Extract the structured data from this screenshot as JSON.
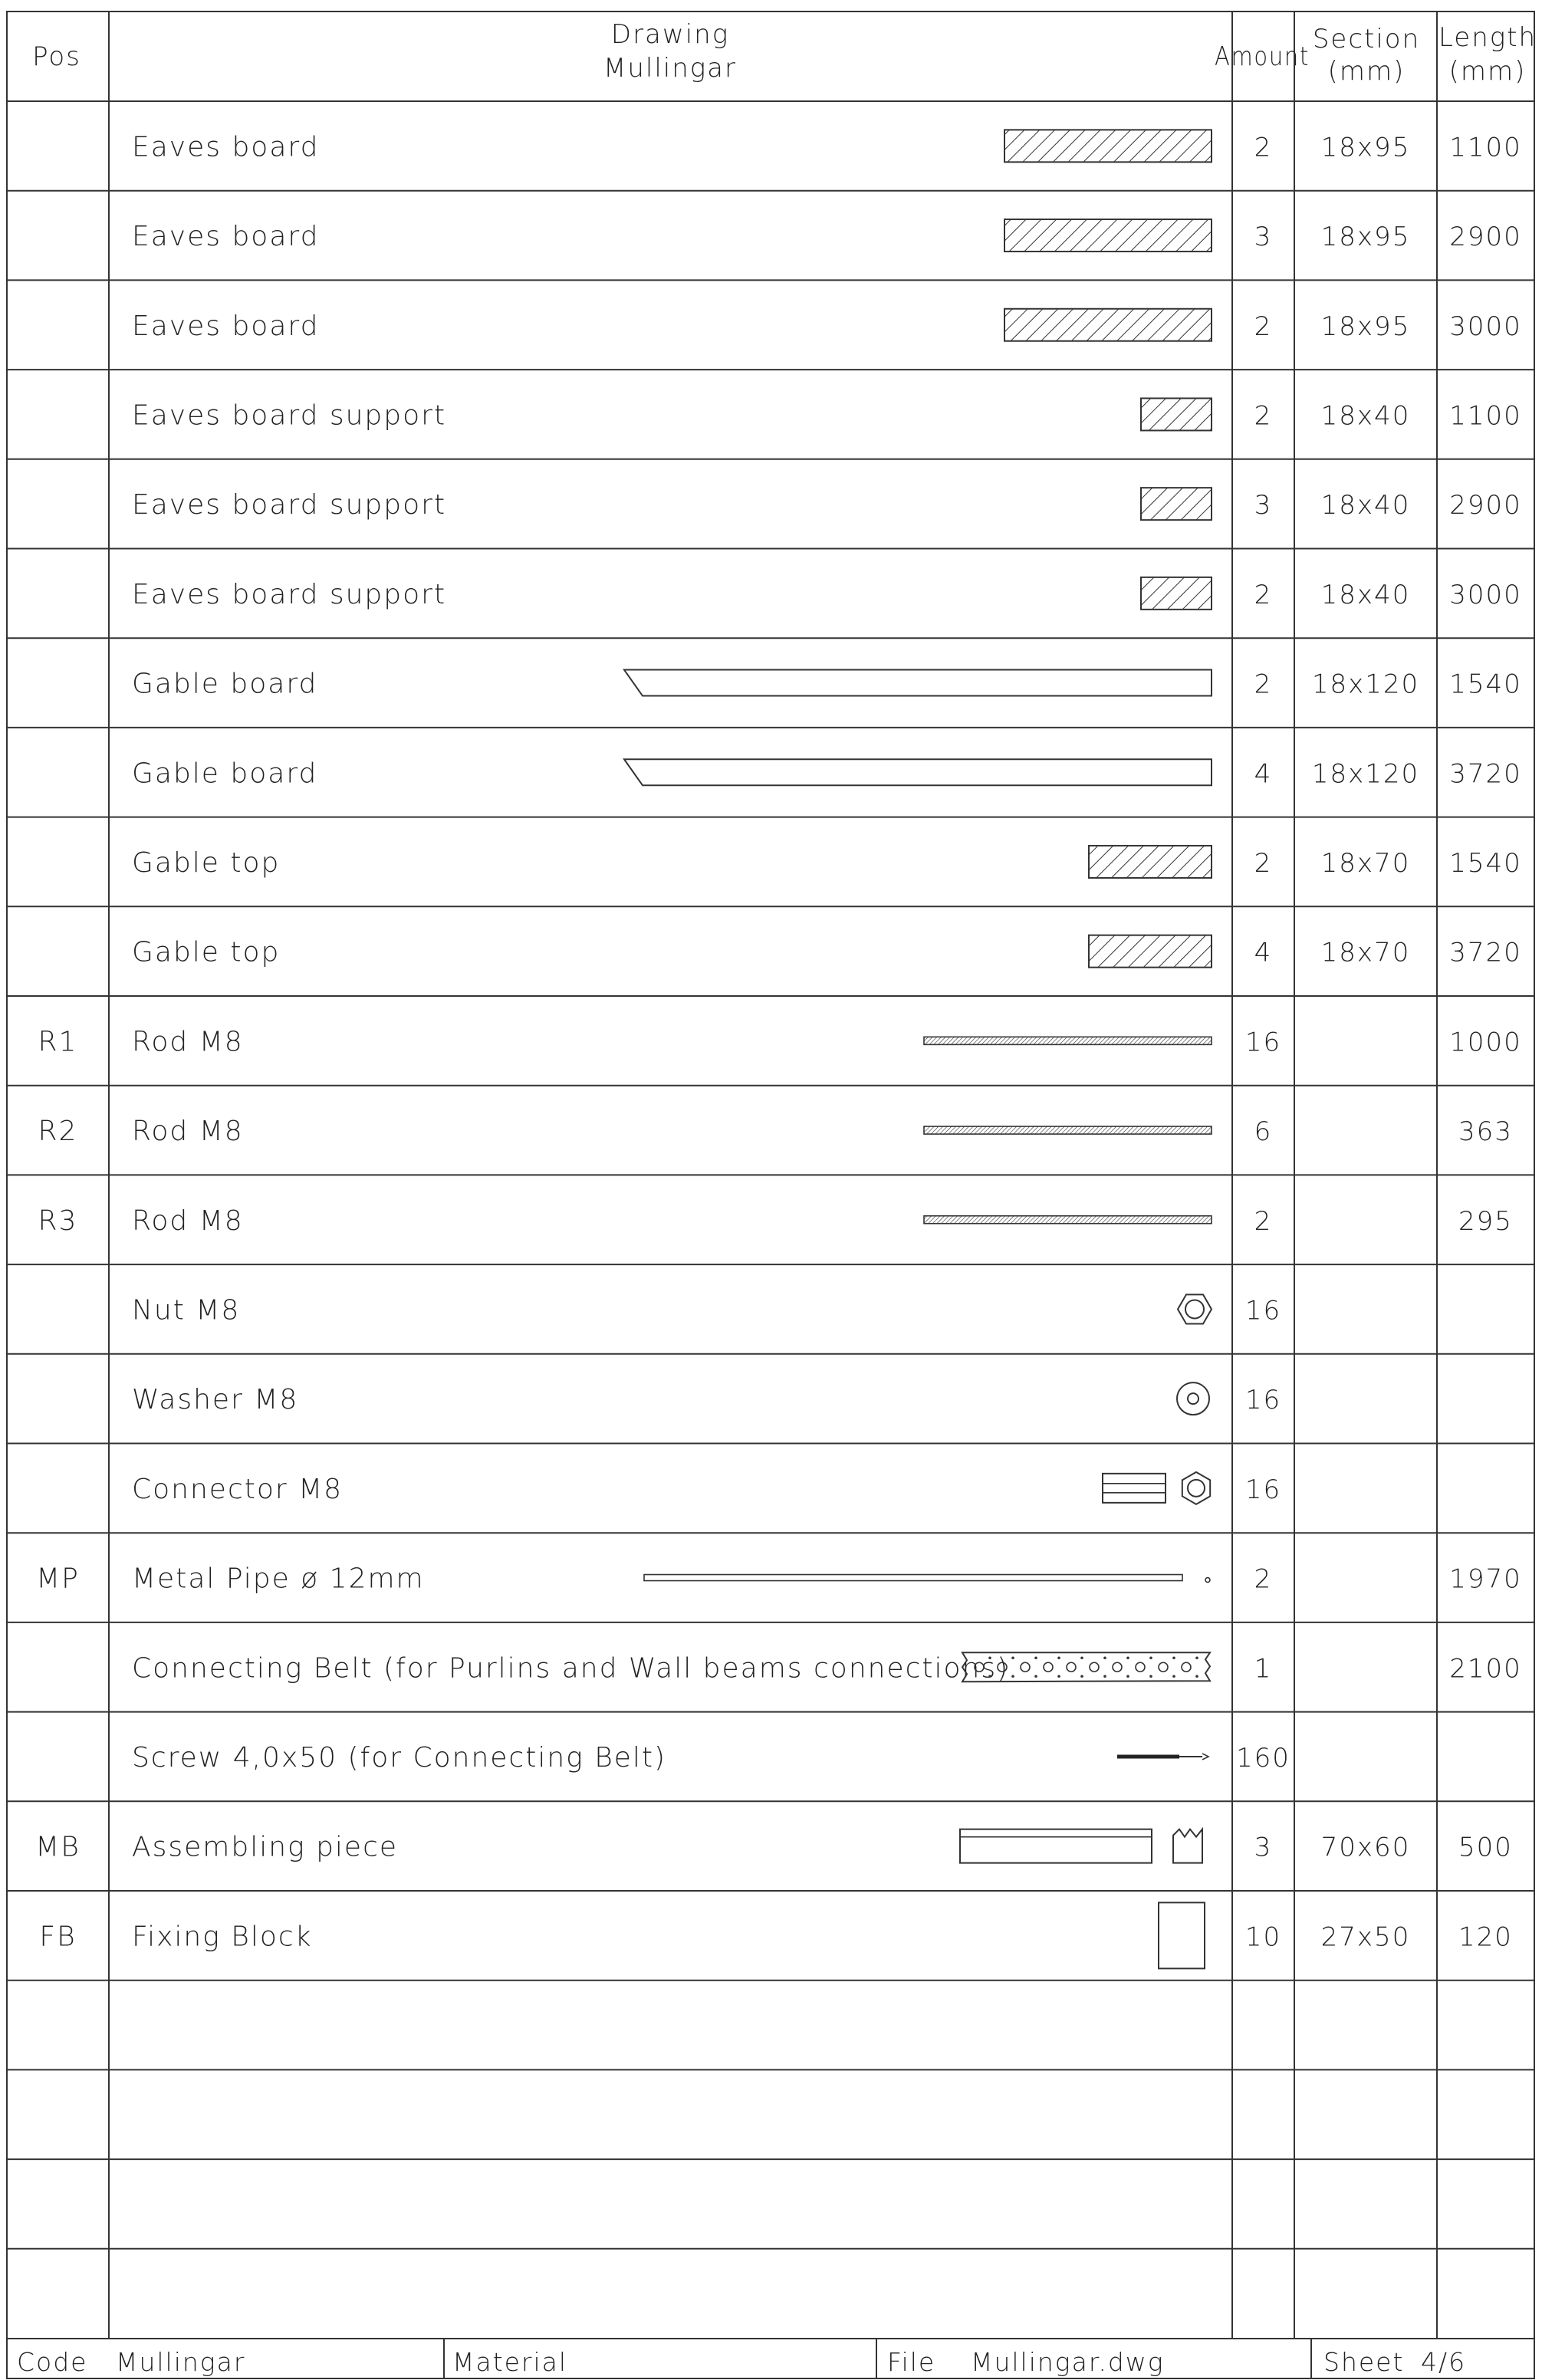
{
  "header": {
    "pos": "Pos",
    "drawing_line1": "Drawing",
    "drawing_line2": "Mullingar",
    "amount": "Amount",
    "section_line1": "Section",
    "section_line2": "(mm)",
    "length_line1": "Length",
    "length_line2": "(mm)"
  },
  "rows": [
    {
      "pos": "",
      "name": "Eaves board",
      "amount": "2",
      "section": "18x95",
      "length": "1100",
      "icon": "hatched-board-icon"
    },
    {
      "pos": "",
      "name": "Eaves board",
      "amount": "3",
      "section": "18x95",
      "length": "2900",
      "icon": "hatched-board-icon"
    },
    {
      "pos": "",
      "name": "Eaves board",
      "amount": "2",
      "section": "18x95",
      "length": "3000",
      "icon": "hatched-board-icon"
    },
    {
      "pos": "",
      "name": "Eaves board support",
      "amount": "2",
      "section": "18x40",
      "length": "1100",
      "icon": "hatched-square-icon"
    },
    {
      "pos": "",
      "name": "Eaves board support",
      "amount": "3",
      "section": "18x40",
      "length": "2900",
      "icon": "hatched-square-icon"
    },
    {
      "pos": "",
      "name": "Eaves board support",
      "amount": "2",
      "section": "18x40",
      "length": "3000",
      "icon": "hatched-square-icon"
    },
    {
      "pos": "",
      "name": "Gable board",
      "amount": "2",
      "section": "18x120",
      "length": "1540",
      "icon": "angled-board-icon"
    },
    {
      "pos": "",
      "name": "Gable board",
      "amount": "4",
      "section": "18x120",
      "length": "3720",
      "icon": "angled-board-icon"
    },
    {
      "pos": "",
      "name": "Gable top",
      "amount": "2",
      "section": "18x70",
      "length": "1540",
      "icon": "hatched-block-icon"
    },
    {
      "pos": "",
      "name": "Gable top",
      "amount": "4",
      "section": "18x70",
      "length": "3720",
      "icon": "hatched-block-icon"
    },
    {
      "pos": "R1",
      "name": "Rod M8",
      "amount": "16",
      "section": "",
      "length": "1000",
      "icon": "threaded-rod-icon"
    },
    {
      "pos": "R2",
      "name": "Rod M8",
      "amount": "6",
      "section": "",
      "length": "363",
      "icon": "threaded-rod-icon"
    },
    {
      "pos": "R3",
      "name": "Rod M8",
      "amount": "2",
      "section": "",
      "length": "295",
      "icon": "threaded-rod-icon"
    },
    {
      "pos": "",
      "name": "Nut M8",
      "amount": "16",
      "section": "",
      "length": "",
      "icon": "hex-nut-icon"
    },
    {
      "pos": "",
      "name": "Washer M8",
      "amount": "16",
      "section": "",
      "length": "",
      "icon": "washer-icon"
    },
    {
      "pos": "",
      "name": "Connector M8",
      "amount": "16",
      "section": "",
      "length": "",
      "icon": "connector-icon"
    },
    {
      "pos": "MP",
      "name": "Metal Pipe ø 12mm",
      "amount": "2",
      "section": "",
      "length": "1970",
      "icon": "metal-pipe-icon"
    },
    {
      "pos": "",
      "name": "Connecting Belt (for Purlins and Wall beams connections)",
      "amount": "1",
      "section": "",
      "length": "2100",
      "icon": "perforated-belt-icon"
    },
    {
      "pos": "",
      "name": "Screw 4,0x50 (for Connecting Belt)",
      "amount": "160",
      "section": "",
      "length": "",
      "icon": "screw-icon"
    },
    {
      "pos": "MB",
      "name": "Assembling piece",
      "amount": "3",
      "section": "70x60",
      "length": "500",
      "icon": "assembling-piece-icon"
    },
    {
      "pos": "FB",
      "name": "Fixing Block",
      "amount": "10",
      "section": "27x50",
      "length": "120",
      "icon": "fixing-block-icon"
    },
    {
      "pos": "",
      "name": "",
      "amount": "",
      "section": "",
      "length": "",
      "icon": ""
    },
    {
      "pos": "",
      "name": "",
      "amount": "",
      "section": "",
      "length": "",
      "icon": ""
    },
    {
      "pos": "",
      "name": "",
      "amount": "",
      "section": "",
      "length": "",
      "icon": ""
    },
    {
      "pos": "",
      "name": "",
      "amount": "",
      "section": "",
      "length": "",
      "icon": ""
    }
  ],
  "footer": {
    "code_label": "Code",
    "code_value": "Mullingar",
    "material_label": "Material",
    "file_label": "File",
    "file_value": "Mullingar.dwg",
    "sheet_label": "Sheet",
    "sheet_value": "4/6"
  }
}
